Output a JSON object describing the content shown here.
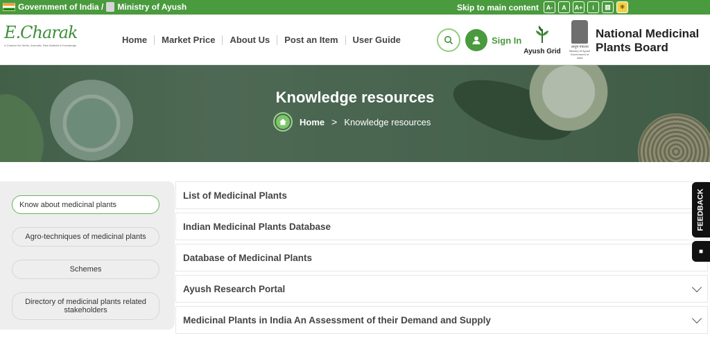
{
  "topbar": {
    "gov_text": "Government of India /",
    "ministry_text": "Ministry of Ayush",
    "skip_text": "Skip to main content",
    "font_decrease": "A-",
    "font_normal": "A",
    "font_increase": "A+",
    "info_icon": "i",
    "sitemap_icon": "▥",
    "theme_icon": "☀"
  },
  "header": {
    "logo_text": "E.Charak",
    "logo_tagline": "e-Channel for Herbs, Aromatic, Raw Material & Knowledge",
    "nav": [
      "Home",
      "Market Price",
      "About Us",
      "Post an Item",
      "User Guide"
    ],
    "signin_label": "Sign In",
    "ayush_grid_label": "Ayush Grid",
    "emblem_hindi": "आयुष मंत्रालय",
    "emblem_sub1": "Ministry of Ayush",
    "emblem_sub2": "Government of India",
    "board_line1": "National Medicinal",
    "board_line2": "Plants Board"
  },
  "hero": {
    "title": "Knowledge resources",
    "crumb_home": "Home",
    "crumb_sep": ">",
    "crumb_current": "Knowledge resources"
  },
  "sidebar": {
    "items": [
      "Know about medicinal plants",
      "Agro-techniques of medicinal plants",
      "Schemes",
      "Directory of medicinal plants related stakeholders"
    ]
  },
  "accordion": {
    "items": [
      "List of Medicinal Plants",
      "Indian Medicinal Plants Database",
      "Database of Medicinal Plants",
      "Ayush Research Portal",
      "Medicinal Plants in India An Assessment of their Demand and Supply"
    ]
  },
  "feedback": {
    "label": "FEEDBACK",
    "video_icon": "■"
  },
  "colors": {
    "brand_green": "#4a9a3e",
    "light_green": "#8ccf7b"
  }
}
